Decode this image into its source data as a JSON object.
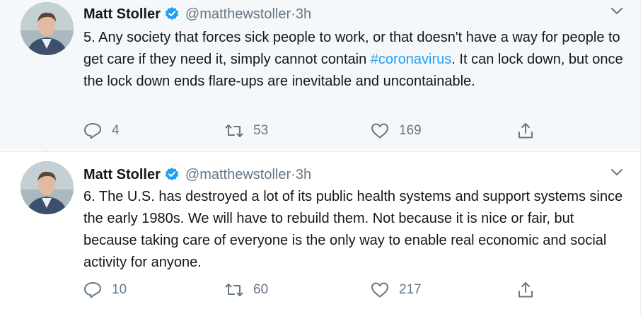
{
  "tweets": [
    {
      "author_name": "Matt Stoller",
      "handle": "@matthewstoller",
      "separator": " · ",
      "time": "3h",
      "text_before_hashtag": "5. Any society that forces sick people to work, or that doesn't have a way for people to get care if they need it, simply cannot contain ",
      "hashtag": "#coronavirus",
      "text_after_hashtag": ". It can lock down, but once the lock down ends flare-ups are inevitable and uncontainable.",
      "replies": "4",
      "retweets": "53",
      "likes": "169"
    },
    {
      "author_name": "Matt Stoller",
      "handle": "@matthewstoller",
      "separator": " · ",
      "time": "3h",
      "text": "6. The U.S. has destroyed a lot of its public health systems and support systems since the early 1980s. We will have to rebuild them. Not because it is nice or fair, but because taking care of everyone is the only way to enable real economic and social activity for anyone.",
      "replies": "10",
      "retweets": "60",
      "likes": "217"
    }
  ],
  "icons": {
    "verified": "verified-badge-icon",
    "menu": "chevron-down-icon",
    "reply": "reply-icon",
    "retweet": "retweet-icon",
    "like": "heart-icon",
    "share": "share-icon"
  },
  "colors": {
    "accent": "#1da1f2",
    "text": "#14171a",
    "muted": "#657786",
    "thread_line": "#ccd6dd",
    "highlight_bg": "#f5f8fa"
  }
}
